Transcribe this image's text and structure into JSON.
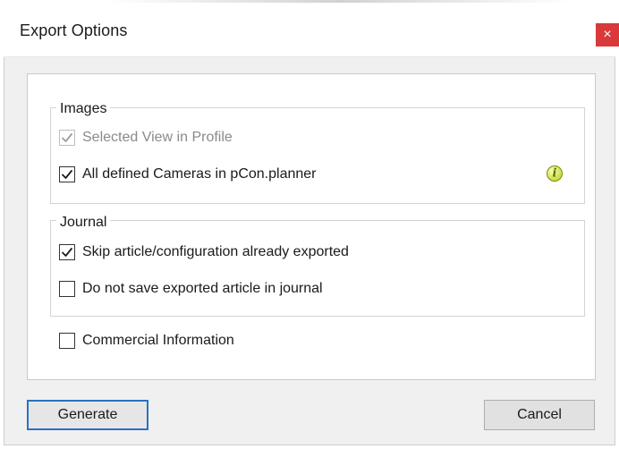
{
  "dialog": {
    "title": "Export Options",
    "close_icon": "close-icon",
    "close_glyph": "×"
  },
  "images": {
    "legend": "Images",
    "options": [
      {
        "label": "Selected View in Profile",
        "checked": true,
        "disabled": true
      },
      {
        "label": "All defined Cameras in pCon.planner",
        "checked": true,
        "disabled": false,
        "info_icon": "info-icon",
        "info_glyph": "i"
      }
    ]
  },
  "journal": {
    "legend": "Journal",
    "options": [
      {
        "label": "Skip article/configuration already exported",
        "checked": true,
        "disabled": false
      },
      {
        "label": "Do not save exported article in journal",
        "checked": false,
        "disabled": false
      }
    ]
  },
  "commercial": {
    "label": "Commercial Information",
    "checked": false,
    "disabled": false
  },
  "buttons": {
    "generate_label": "Generate",
    "cancel_label": "Cancel"
  },
  "colors": {
    "close_bg": "#d9393a",
    "focus_border": "#2b71c3",
    "info_green": "#b9cd28"
  }
}
